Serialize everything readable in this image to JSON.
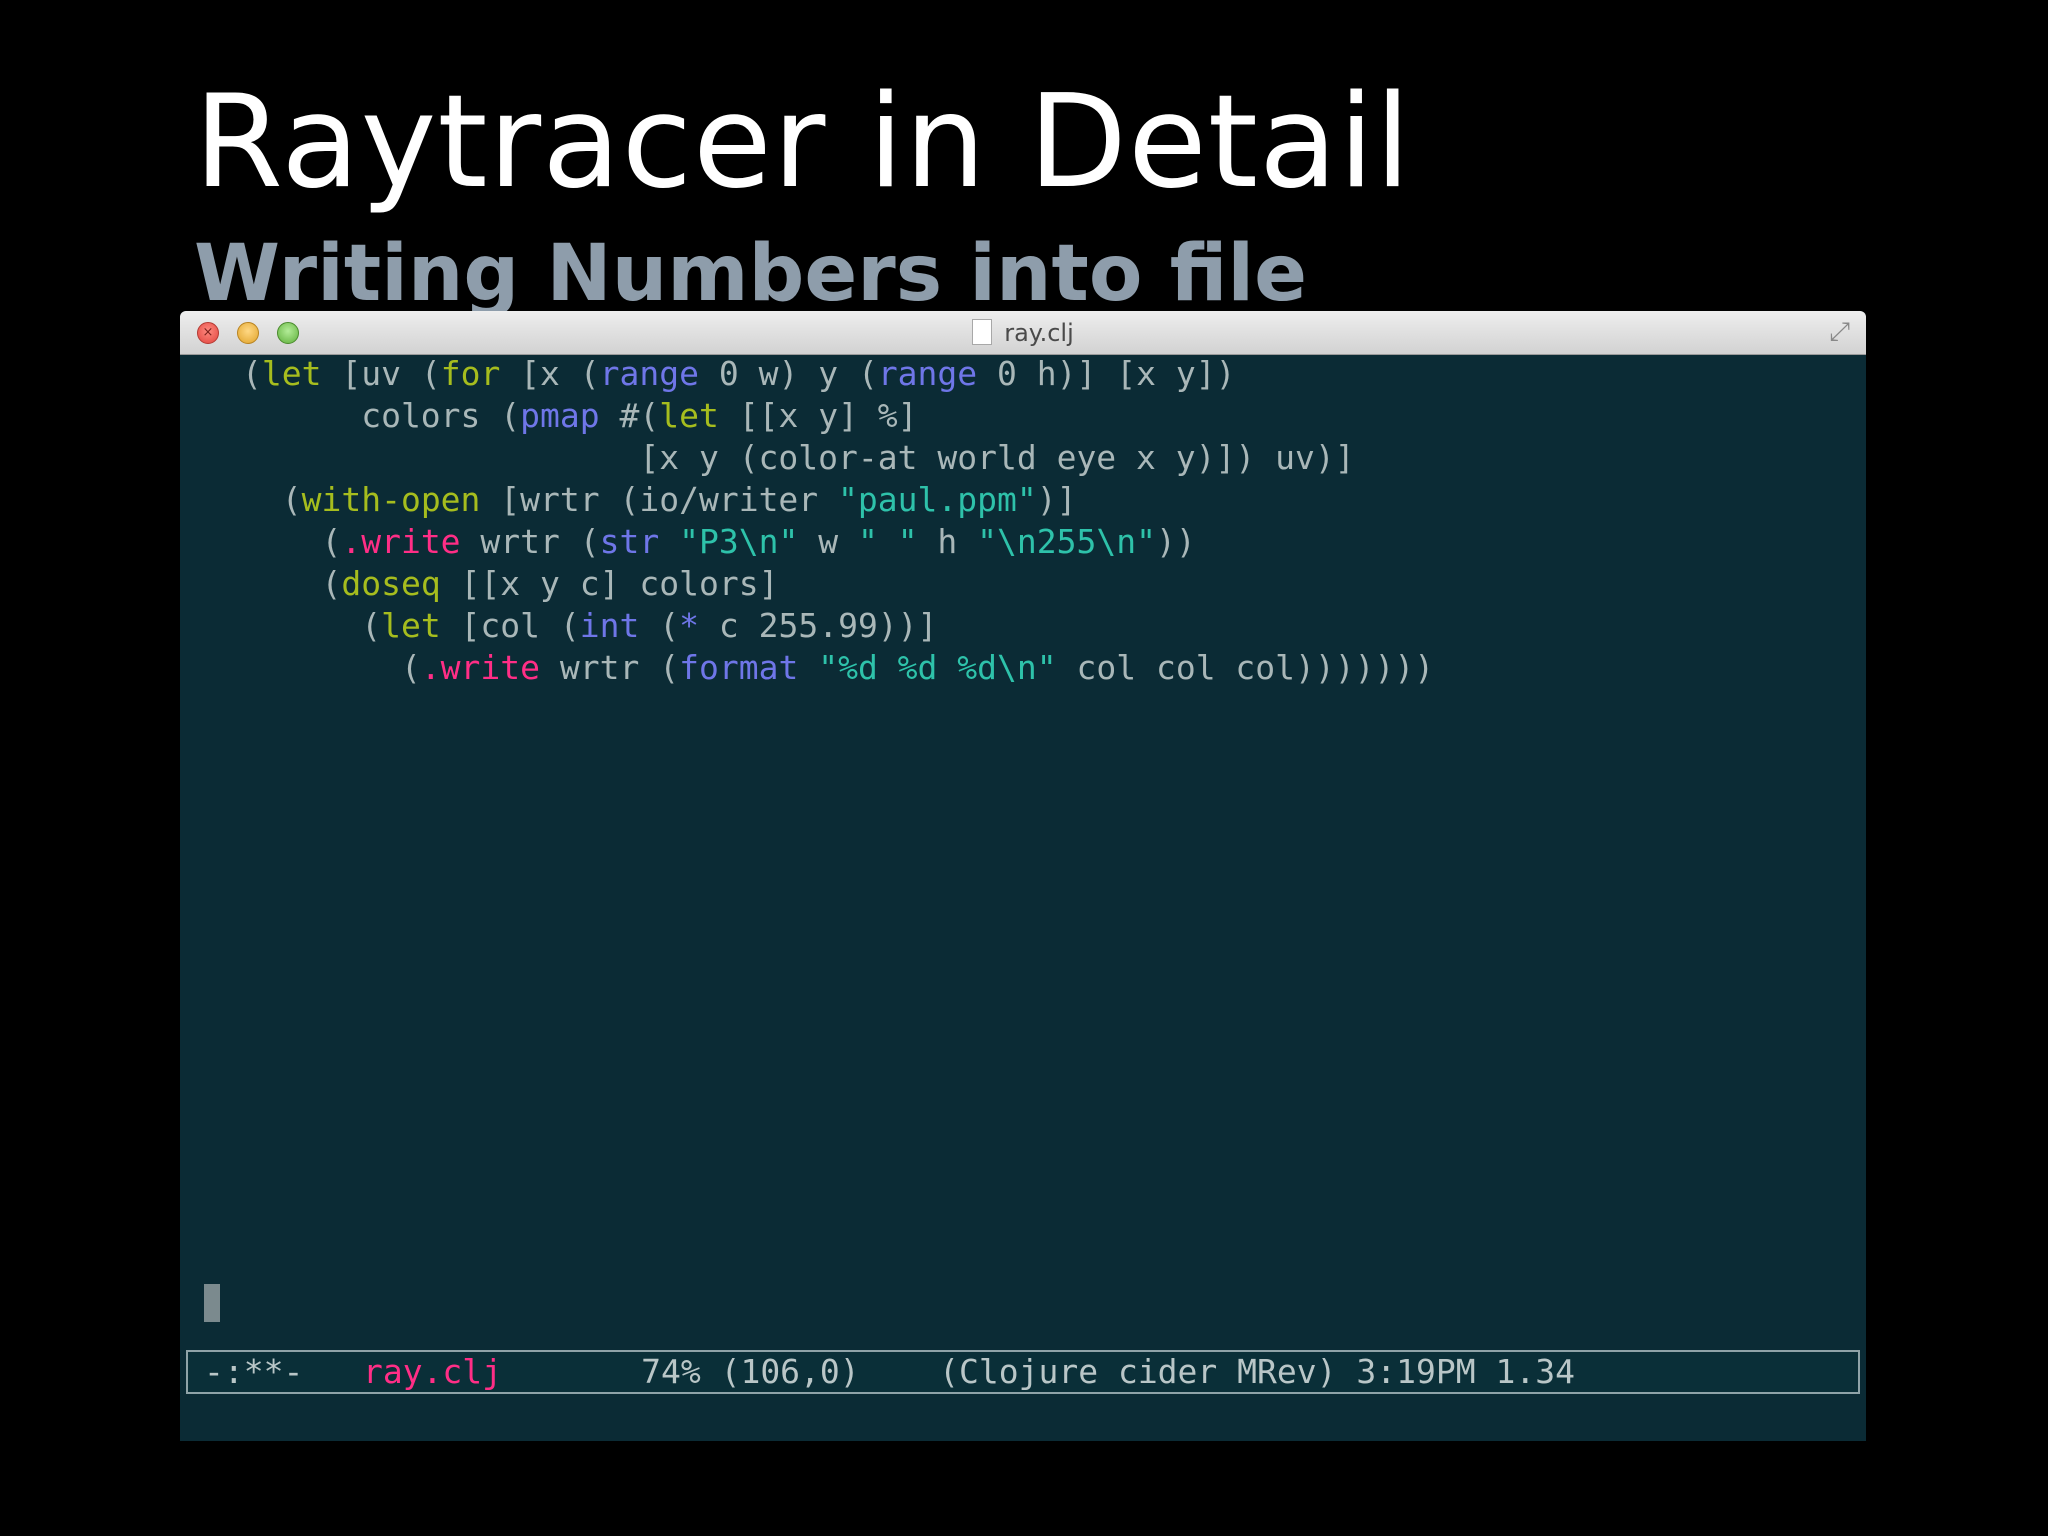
{
  "slide": {
    "title": "Raytracer in Detail",
    "subtitle": "Writing Numbers into file"
  },
  "window": {
    "title": "ray.clj",
    "controls": {
      "close_icon": "close-icon",
      "minimize_icon": "minimize-icon",
      "zoom_icon": "zoom-icon",
      "fullscreen_icon": "expand-icon"
    }
  },
  "editor": {
    "code_lines": [
      [
        {
          "t": "(",
          "c": "mono"
        },
        {
          "t": "let",
          "c": "kw"
        },
        {
          "t": " [uv (",
          "c": "mono"
        },
        {
          "t": "for",
          "c": "kw"
        },
        {
          "t": " [x (",
          "c": "mono"
        },
        {
          "t": "range",
          "c": "fn"
        },
        {
          "t": " 0 w) y (",
          "c": "mono"
        },
        {
          "t": "range",
          "c": "fn"
        },
        {
          "t": " 0 h)] [x y])",
          "c": "mono"
        }
      ],
      [
        {
          "t": "      colors (",
          "c": "mono"
        },
        {
          "t": "pmap",
          "c": "fn"
        },
        {
          "t": " #(",
          "c": "mono"
        },
        {
          "t": "let",
          "c": "kw"
        },
        {
          "t": " [[x y] %]",
          "c": "mono"
        }
      ],
      [
        {
          "t": "                    [x y (color-at world eye x y)]) uv)]",
          "c": "mono"
        }
      ],
      [
        {
          "t": "  (",
          "c": "mono"
        },
        {
          "t": "with-open",
          "c": "kw"
        },
        {
          "t": " [wrtr (io/writer ",
          "c": "mono"
        },
        {
          "t": "\"paul.ppm\"",
          "c": "str"
        },
        {
          "t": ")]",
          "c": "mono"
        }
      ],
      [
        {
          "t": "    (",
          "c": "mono"
        },
        {
          "t": ".write",
          "c": "jm"
        },
        {
          "t": " wrtr (",
          "c": "mono"
        },
        {
          "t": "str",
          "c": "fn"
        },
        {
          "t": " ",
          "c": "mono"
        },
        {
          "t": "\"P3\\n\"",
          "c": "str"
        },
        {
          "t": " w ",
          "c": "mono"
        },
        {
          "t": "\" \"",
          "c": "str"
        },
        {
          "t": " h ",
          "c": "mono"
        },
        {
          "t": "\"\\n255\\n\"",
          "c": "str"
        },
        {
          "t": "))",
          "c": "mono"
        }
      ],
      [
        {
          "t": "    (",
          "c": "mono"
        },
        {
          "t": "doseq",
          "c": "kw"
        },
        {
          "t": " [[x y c] colors]",
          "c": "mono"
        }
      ],
      [
        {
          "t": "      (",
          "c": "mono"
        },
        {
          "t": "let",
          "c": "kw"
        },
        {
          "t": " [col (",
          "c": "mono"
        },
        {
          "t": "int",
          "c": "fn"
        },
        {
          "t": " (",
          "c": "mono"
        },
        {
          "t": "*",
          "c": "fn"
        },
        {
          "t": " c 255.99))]",
          "c": "mono"
        }
      ],
      [
        {
          "t": "        (",
          "c": "mono"
        },
        {
          "t": ".write",
          "c": "jm"
        },
        {
          "t": " wrtr (",
          "c": "mono"
        },
        {
          "t": "format",
          "c": "fn"
        },
        {
          "t": " ",
          "c": "mono"
        },
        {
          "t": "\"%d %d %d\\n\"",
          "c": "str"
        },
        {
          "t": " col col col)))))))",
          "c": "mono"
        }
      ]
    ]
  },
  "modeline": {
    "status": "-:**-",
    "buffer": "ray.clj",
    "position": "74% (106,0)",
    "modes": "(Clojure cider MRev)",
    "time": "3:19PM",
    "load": "1.34"
  },
  "colors": {
    "keyword": "#a6bd1e",
    "function": "#6f76e8",
    "string": "#2ec2aa",
    "java_method": "#ff2e86",
    "text": "#a9b7b8",
    "editor_bg": "#0b2b35"
  }
}
